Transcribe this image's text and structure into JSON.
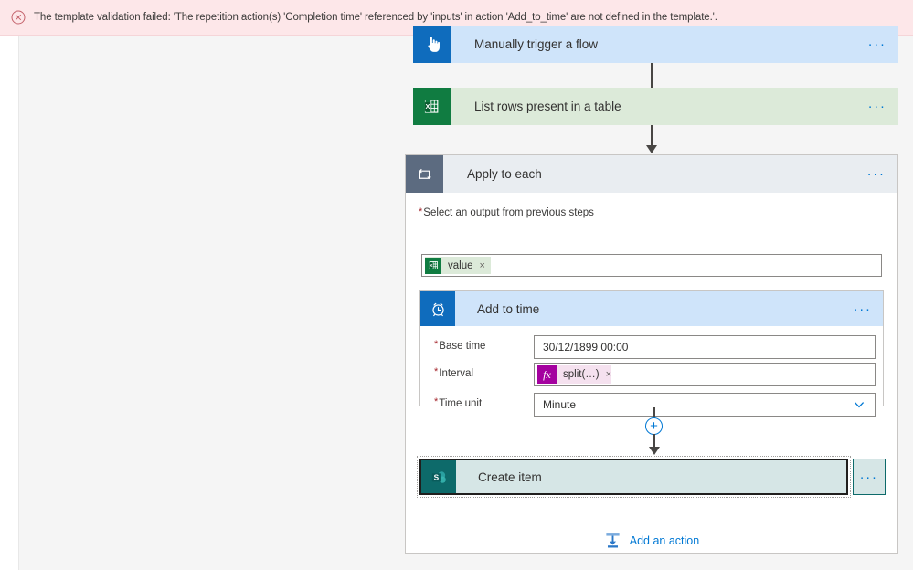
{
  "error_banner": {
    "icon": "error-circle-icon",
    "message": "The template validation failed: 'The repetition action(s) 'Completion time' referenced by 'inputs' in action 'Add_to_time' are not defined in the template.'."
  },
  "flow": {
    "trigger_card": {
      "title": "Manually trigger a flow",
      "icon": "manual-trigger-hand-icon",
      "icon_color": "#0f6cbd",
      "background": "#cfe4fa",
      "menu": "..."
    },
    "list_rows_card": {
      "title": "List rows present in a table",
      "icon": "excel-icon",
      "icon_color": "#107c41",
      "background": "#dcead9",
      "menu": "..."
    },
    "apply_to_each": {
      "title": "Apply to each",
      "icon": "loop-repeat-icon",
      "icon_color": "#5c6b80",
      "background": "#e9edf1",
      "menu": "...",
      "select_output": {
        "label": "Select an output from previous steps",
        "required_marker": "*",
        "token": {
          "icon": "excel-icon",
          "label": "value",
          "remove": "×"
        }
      },
      "add_to_time": {
        "title": "Add to time",
        "icon": "alarm-clock-icon",
        "icon_color": "#0f6cbd",
        "background": "#cfe4fa",
        "menu": "...",
        "fields": [
          {
            "label": "Base time",
            "required_marker": "*",
            "type": "text",
            "value": "30/12/1899 00:00"
          },
          {
            "label": "Interval",
            "required_marker": "*",
            "type": "token",
            "token": {
              "badge": "fx",
              "label": "split(…)",
              "remove": "×"
            }
          },
          {
            "label": "Time unit",
            "required_marker": "*",
            "type": "dropdown",
            "value": "Minute",
            "chevron": "chevron-down-icon"
          }
        ]
      },
      "insert_step_button": {
        "icon": "plus-circle-icon",
        "label": "+"
      },
      "create_item": {
        "title": "Create item",
        "icon": "sharepoint-icon",
        "icon_color": "#0d6a6a",
        "background": "#d6e6e6",
        "selected": "true",
        "menu": "..."
      },
      "add_action_link": {
        "icon": "add-action-icon",
        "label": "Add an action"
      }
    }
  },
  "colors": {
    "error_bg": "#fde7e9",
    "error_fg": "#a4262c",
    "accent_blue": "#0078d4",
    "excel_green": "#107c41",
    "sharepoint_teal": "#0d6a6a",
    "fx_magenta": "#a4019f",
    "canvas_bg": "#f5f5f5"
  }
}
